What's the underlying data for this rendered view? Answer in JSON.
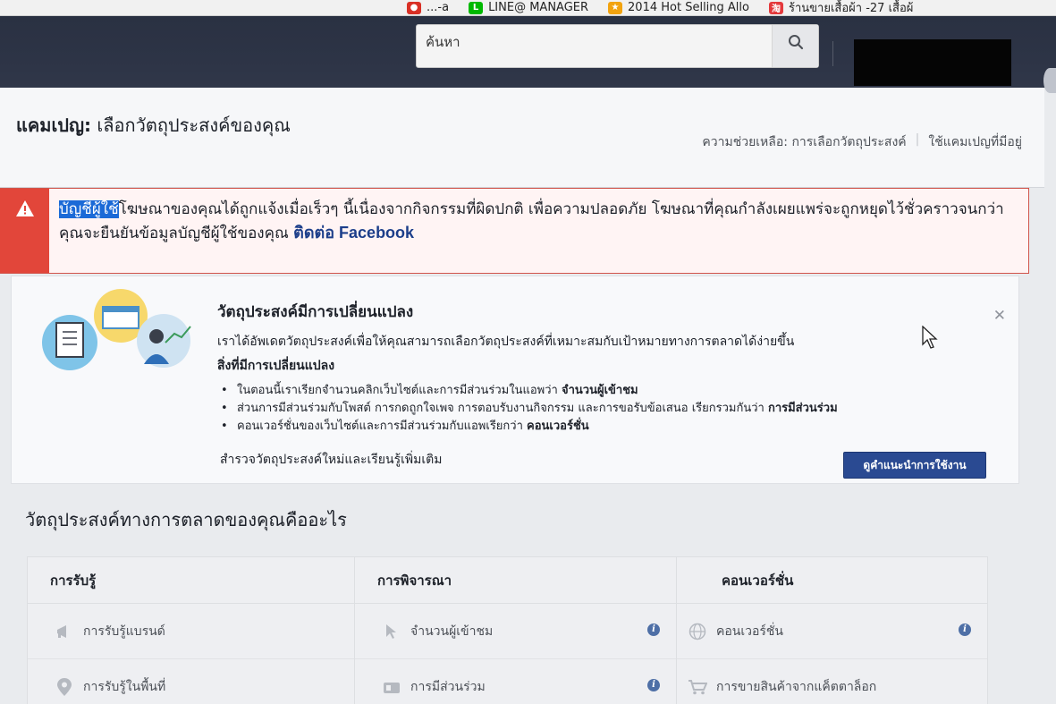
{
  "browser": {
    "bookmarks": [
      {
        "label": "...-a",
        "icon": "bookmark-red-icon"
      },
      {
        "label": "LINE@ MANAGER",
        "icon": "line-icon"
      },
      {
        "label": "2014 Hot Selling Allo",
        "icon": "bookmark-yellow-icon"
      },
      {
        "label": "ร้านขายเสื้อผ้า -27 เสื้อผ้",
        "icon": "taobao-icon"
      }
    ]
  },
  "topbar": {
    "search_placeholder": "ค้นหา"
  },
  "header": {
    "title_prefix": "แคมเปญ:",
    "title_text": " เลือกวัตถุประสงค์ของคุณ",
    "help_link": "ความช่วยเหลือ: การเลือกวัตถุประสงค์",
    "existing_link": "ใช้แคมเปญที่มีอยู่"
  },
  "warning": {
    "highlighted": "บัญชีผู้ใช้",
    "message": "โฆษณาของคุณได้ถูกแจ้งเมื่อเร็วๆ นี้เนื่องจากกิจกรรมที่ผิดปกติ เพื่อความปลอดภัย โฆษณาที่คุณกำลังเผยแพร่จะถูกหยุดไว้ชั่วคราวจนกว่าคุณจะยืนยันข้อมูลบัญชีผู้ใช้ของคุณ ",
    "link": "ติดต่อ Facebook",
    "accent": "#e2463a"
  },
  "change_card": {
    "title": "วัตถุประสงค์มีการเปลี่ยนแปลง",
    "description": "เราได้อัพเดตวัตถุประสงค์เพื่อให้คุณสามารถเลือกวัตถุประสงค์ที่เหมาะสมกับเป้าหมายทางการตลาดได้ง่ายขึ้น",
    "subtitle": "สิ่งที่มีการเปลี่ยนแปลง",
    "bullets": [
      {
        "text": "ในตอนนี้เราเรียกจำนวนคลิกเว็บไซต์และการมีส่วนร่วมในแอพว่า ",
        "bold": "จำนวนผู้เข้าชม"
      },
      {
        "text": "ส่วนการมีส่วนร่วมกับโพสต์ การกดถูกใจเพจ การตอบรับงานกิจกรรม และการขอรับข้อเสนอ เรียกรวมกันว่า ",
        "bold": "การมีส่วนร่วม"
      },
      {
        "text": "คอนเวอร์ชั่นของเว็บไซต์และการมีส่วนร่วมกับแอพเรียกว่า ",
        "bold": "คอนเวอร์ชั่น"
      }
    ],
    "learn_link": "สำรวจวัตถุประสงค์ใหม่และเรียนรู้เพิ่มเติม",
    "tour_button": "ดูคำแนะนำการใช้งาน",
    "close": "✕",
    "button_color": "#2a4a92"
  },
  "objectives": {
    "title": "วัตถุประสงค์ทางการตลาดของคุณคืออะไร",
    "columns": [
      {
        "header": "การรับรู้",
        "items": [
          {
            "label": "การรับรู้แบรนด์",
            "icon": "megaphone-icon"
          },
          {
            "label": "การรับรู้ในพื้นที่",
            "icon": "location-pin-icon"
          }
        ]
      },
      {
        "header": "การพิจารณา",
        "items": [
          {
            "label": "จำนวนผู้เข้าชม",
            "icon": "cursor-click-icon"
          },
          {
            "label": "การมีส่วนร่วม",
            "icon": "engagement-icon"
          }
        ]
      },
      {
        "header": "คอนเวอร์ชั่น",
        "items": [
          {
            "label": "คอนเวอร์ชั่น",
            "icon": "globe-icon"
          },
          {
            "label": "การขายสินค้าจากแค็ตตาล็อก",
            "icon": "shopping-cart-icon"
          }
        ]
      }
    ]
  }
}
